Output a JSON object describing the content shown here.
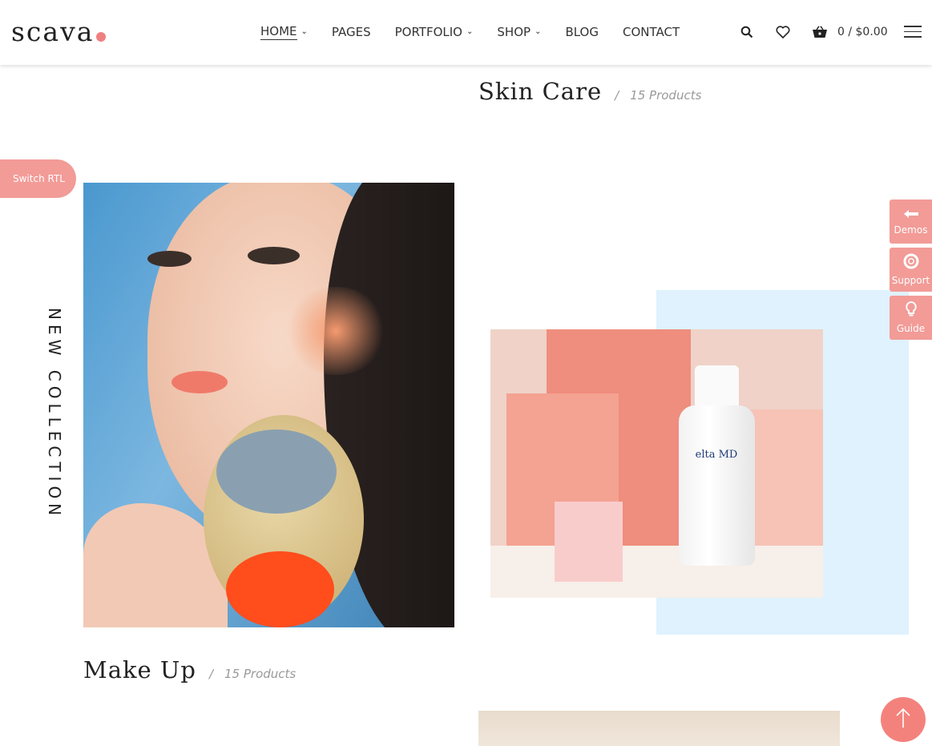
{
  "header": {
    "logo_text": "scava",
    "nav": [
      {
        "label": "HOME",
        "dropdown": true,
        "active": true
      },
      {
        "label": "PAGES",
        "dropdown": false
      },
      {
        "label": "PORTFOLIO",
        "dropdown": true
      },
      {
        "label": "SHOP",
        "dropdown": true
      },
      {
        "label": "BLOG",
        "dropdown": false
      },
      {
        "label": "CONTACT",
        "dropdown": false
      }
    ],
    "icons": [
      "search-icon",
      "heart-icon",
      "basket-icon",
      "hamburger-menu-icon"
    ],
    "cart_text": "0 / $0.00"
  },
  "sections": {
    "skin_care": {
      "name": "Skin Care",
      "separator": "/",
      "count": "15 Products"
    },
    "make_up": {
      "name": "Make Up",
      "separator": "/",
      "count": "15 Products"
    }
  },
  "switch_rtl": "Switch RTL",
  "vertical_text": "NEW COLLECTION",
  "product_label": "elta MD",
  "side_buttons": [
    {
      "label": "Demos",
      "icon": "arrow-left-icon"
    },
    {
      "label": "Support",
      "icon": "lifebuoy-icon"
    },
    {
      "label": "Guide",
      "icon": "lightbulb-icon"
    }
  ],
  "colors": {
    "accent": "#f29b97",
    "light_blue": "#dff2fd",
    "text": "#222222"
  }
}
